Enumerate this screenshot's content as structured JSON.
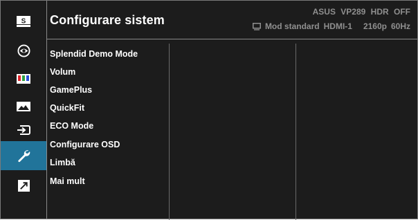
{
  "header": {
    "title": "Configurare sistem",
    "model": "ASUS  VP289 HDR OFF",
    "mode": "Mod standard",
    "input": "HDMI-1",
    "resolution": "2160p",
    "refresh": "60Hz"
  },
  "sidebar": {
    "items": [
      {
        "name": "splendid-icon",
        "label": "S"
      },
      {
        "name": "eye-care-icon"
      },
      {
        "name": "color-icon"
      },
      {
        "name": "image-icon"
      },
      {
        "name": "input-select-icon"
      },
      {
        "name": "system-setup-icon",
        "active": true
      },
      {
        "name": "shortcut-icon"
      }
    ],
    "active_color": "#21749a"
  },
  "menu": {
    "items": [
      "Splendid Demo Mode",
      "Volum",
      "GamePlus",
      "QuickFit",
      "ECO Mode",
      "Configurare OSD",
      "Limbă",
      "Mai mult"
    ]
  }
}
